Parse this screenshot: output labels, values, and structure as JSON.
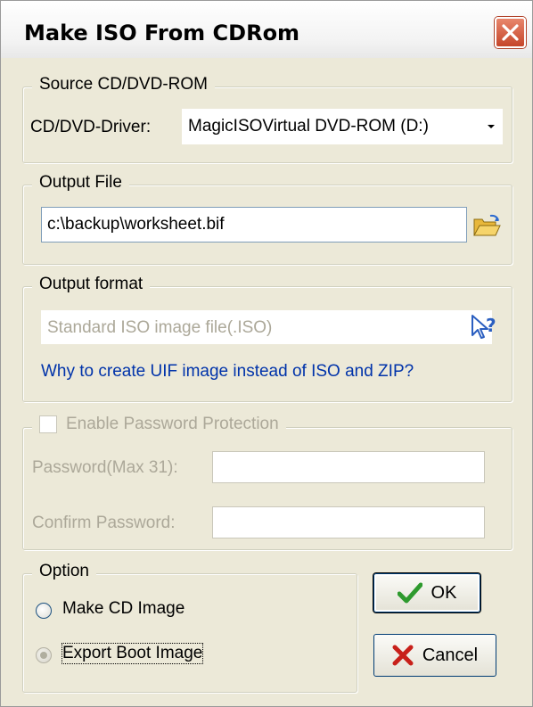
{
  "dialog": {
    "title": "Make ISO From CDRom"
  },
  "source": {
    "legend": "Source CD/DVD-ROM",
    "driver_label": "CD/DVD-Driver:",
    "driver_value": "MagicISOVirtual DVD-ROM  (D:)"
  },
  "output_file": {
    "legend": "Output File",
    "path_value": "c:\\backup\\worksheet.bif"
  },
  "output_format": {
    "legend": "Output format",
    "format_value": "Standard ISO image file(.ISO)",
    "help_link": "Why to create UIF image instead of ISO and ZIP?"
  },
  "password": {
    "enable_label": "Enable Password Protection",
    "password_label": "Password(Max 31):",
    "confirm_label": "Confirm Password:",
    "password_value": "",
    "confirm_value": "",
    "enabled": false
  },
  "option": {
    "legend": "Option",
    "make_cd_label": "Make CD Image",
    "export_boot_label": "Export Boot Image",
    "selected": "export_boot"
  },
  "buttons": {
    "ok_label": "OK",
    "cancel_label": "Cancel"
  },
  "icons": {
    "close": "close-icon",
    "browse": "open-folder-icon",
    "help": "help-pointer-icon",
    "ok": "checkmark-icon",
    "cancel": "x-icon"
  },
  "colors": {
    "link": "#0033aa",
    "disabled_text": "#aca899",
    "close_button": "#c5462a",
    "ok_check": "#2e9a2e",
    "cancel_x": "#c8201a"
  }
}
